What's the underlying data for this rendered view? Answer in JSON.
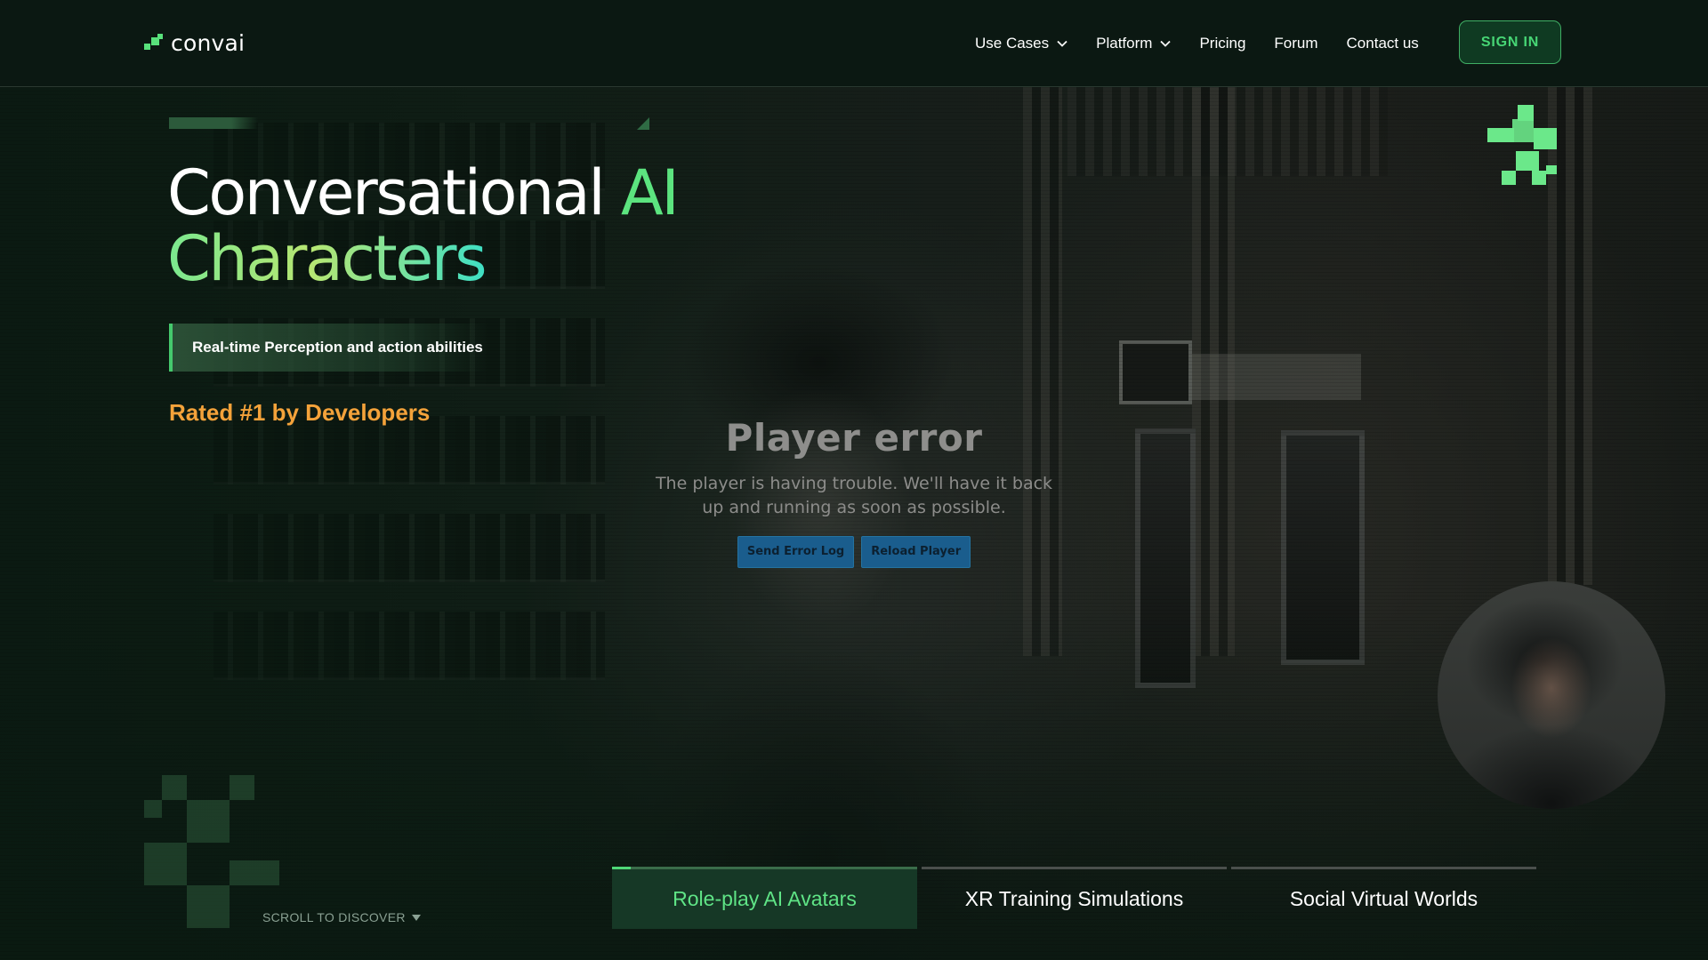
{
  "brand": {
    "name": "convai",
    "accent_color": "#58e17b",
    "logo_icon": "convai-logo-icon"
  },
  "nav": {
    "items": [
      {
        "label": "Use Cases",
        "has_dropdown": true
      },
      {
        "label": "Platform",
        "has_dropdown": true
      },
      {
        "label": "Pricing",
        "has_dropdown": false
      },
      {
        "label": "Forum",
        "has_dropdown": false
      },
      {
        "label": "Contact us",
        "has_dropdown": false
      }
    ],
    "sign_in_label": "SIGN IN"
  },
  "hero": {
    "title_part1": "Conversational ",
    "title_ai": "AI",
    "title_part2": "Characters",
    "perception_label": "Real-time Perception and action abilities",
    "rated_label": "Rated #1 by Developers",
    "rated_color": "#f4a23a"
  },
  "player": {
    "error_title": "Player error",
    "error_message": "The player is having trouble. We'll have it back up and running as soon as possible.",
    "send_log_label": "Send Error Log",
    "reload_label": "Reload Player"
  },
  "scroll": {
    "label": "SCROLL TO DISCOVER",
    "icon": "caret-down-icon"
  },
  "tabs": {
    "items": [
      {
        "label": "Role-play AI Avatars",
        "active": true,
        "progress": 0.06
      },
      {
        "label": "XR Training Simulations",
        "active": false
      },
      {
        "label": "Social Virtual Worlds",
        "active": false
      }
    ]
  },
  "colors": {
    "background": "#0a140f",
    "navbar": "#0b1812",
    "signin_text": "#47d675",
    "active_tab_bg": "#163826",
    "active_tab_text": "#5fe486",
    "player_button": "#1a5d8d"
  }
}
